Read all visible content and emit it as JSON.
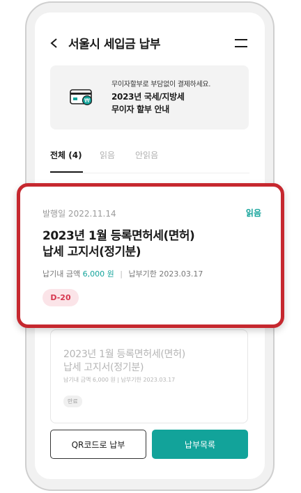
{
  "header": {
    "title": "서울시 세입금 납부"
  },
  "banner": {
    "subtitle": "무이자할부로 부담없이 결제하세요.",
    "title_line1": "2023년 국세/지방세",
    "title_line2": "무이자 할부 안내"
  },
  "tabs": [
    {
      "label": "전체 (4)",
      "active": true
    },
    {
      "label": "읽음",
      "active": false
    },
    {
      "label": "안읽음",
      "active": false
    }
  ],
  "highlighted_notice": {
    "issue_date": "발행일 2022.11.14",
    "status": "읽음",
    "title_line1": "2023년 1월 등록면허세(면허)",
    "title_line2": "납세 고지서(정기분)",
    "amount_label": "납기내 금액",
    "amount_value": "6,000 원",
    "separator": "|",
    "due_label": "납부기한",
    "due_date": "2023.03.17",
    "badge": "D-20"
  },
  "background_notice": {
    "title_line1": "2023년 1월 등록면허세(면허)",
    "title_line2": "납세 고지서(정기분)",
    "meta": "납기내 금액 6,000 원  |  납부기한 2023.03.17",
    "badge": "만료"
  },
  "buttons": {
    "qr_label": "QR코드로 납부",
    "list_label": "납부목록"
  },
  "colors": {
    "accent": "#12a39a",
    "highlight_border": "#c6282f",
    "badge_bg": "#fbe4e8",
    "badge_text": "#d7374f"
  }
}
